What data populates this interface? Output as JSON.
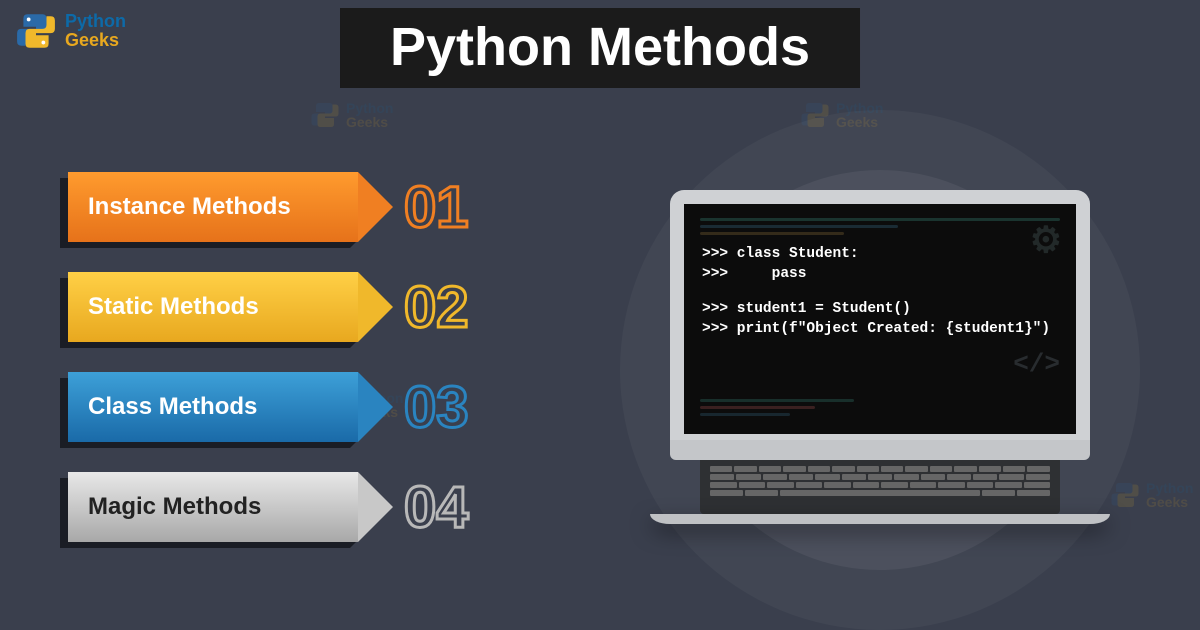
{
  "logo": {
    "line1": "Python",
    "line2": "Geeks"
  },
  "title": "Python Methods",
  "arrows": [
    {
      "label": "Instance Methods",
      "num": "01"
    },
    {
      "label": "Static Methods",
      "num": "02"
    },
    {
      "label": "Class Methods",
      "num": "03"
    },
    {
      "label": "Magic Methods",
      "num": "04"
    }
  ],
  "code": {
    "line1": ">>> class Student:",
    "line2": ">>>     pass",
    "line3": ">>> student1 = Student()",
    "line4": ">>> print(f\"Object Created: {student1}\")"
  },
  "colors": {
    "bg": "#3a3f4d",
    "arrow1": "#f07f22",
    "arrow2": "#f0b82b",
    "arrow3": "#2a84c0",
    "arrow4": "#c8c8c8"
  }
}
